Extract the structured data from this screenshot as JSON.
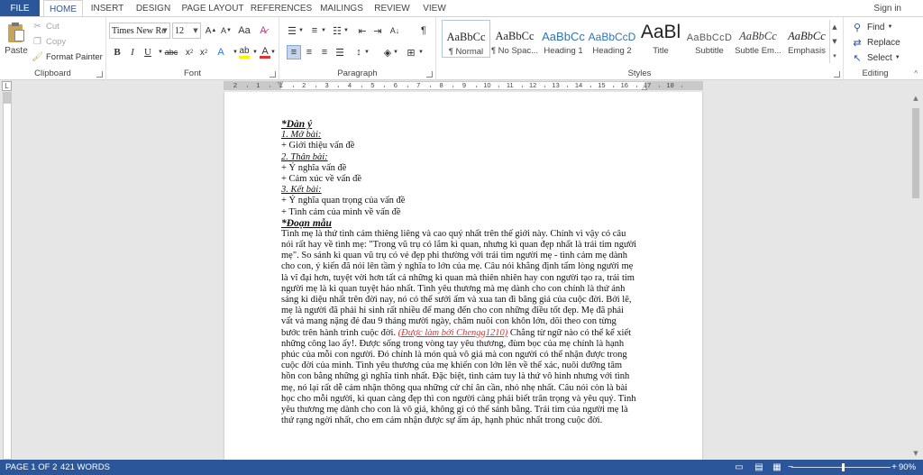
{
  "tabs": {
    "file": "FILE",
    "home": "HOME",
    "insert": "INSERT",
    "design": "DESIGN",
    "page_layout": "PAGE LAYOUT",
    "references": "REFERENCES",
    "mailings": "MAILINGS",
    "review": "REVIEW",
    "view": "VIEW",
    "sign_in": "Sign in"
  },
  "clipboard": {
    "paste": "Paste",
    "cut": "Cut",
    "copy": "Copy",
    "format_painter": "Format Painter",
    "label": "Clipboard"
  },
  "font": {
    "name": "Times New Ro",
    "size": "12",
    "label": "Font"
  },
  "paragraph": {
    "label": "Paragraph"
  },
  "styles": {
    "label": "Styles",
    "items": [
      {
        "sample": "AaBbCc",
        "name": "¶ Normal"
      },
      {
        "sample": "AaBbCc",
        "name": "¶ No Spac..."
      },
      {
        "sample": "AaBbCc",
        "name": "Heading 1"
      },
      {
        "sample": "AaBbCcD",
        "name": "Heading 2"
      },
      {
        "sample": "AaBl",
        "name": "Title"
      },
      {
        "sample": "AaBbCcD",
        "name": "Subtitle"
      },
      {
        "sample": "AaBbCc",
        "name": "Subtle Em..."
      },
      {
        "sample": "AaBbCc",
        "name": "Emphasis"
      }
    ]
  },
  "editing": {
    "find": "Find",
    "replace": "Replace",
    "select": "Select",
    "label": "Editing"
  },
  "ruler": {
    "labels": [
      "2",
      "1",
      "1",
      "2",
      "3",
      "4",
      "5",
      "6",
      "7",
      "8",
      "9",
      "10",
      "11",
      "12",
      "13",
      "14",
      "15",
      "16",
      "17",
      "18"
    ]
  },
  "document": {
    "outline_title": "*Dàn ý",
    "mo_bai": "1. Mở bài:",
    "l1": "+ Giới thiệu vấn đề",
    "than_bai": "2. Thân bài:",
    "l2": "+ Ý nghĩa vấn đề",
    "l3": "+ Cảm xúc về vấn đề",
    "ket_bai": "3. Kết bài:",
    "l4": "+ Ý nghĩa quan trọng của vấn đề",
    "l5": "+ Tình cảm của mình về vấn đề",
    "para_title": "*Đoạn mẫu",
    "p": [
      "Tình mẹ là thứ tình cảm thiêng liêng và cao quý nhất trên thế giới này. Chính vì vậy có câu",
      "nói rất hay về tình mẹ: \"Trong vũ trụ có lắm kì quan, nhưng kì quan đẹp nhất là trái tim người",
      "mẹ\". So sánh kì quan vũ trụ có vẻ đẹp phi thường với trái tim người mẹ - tình cảm mẹ dành",
      "cho con, ý kiến đã nói lên tầm ý nghĩa to lớn của mẹ. Câu nói khẳng định tấm lòng người mẹ",
      "là vĩ đại hơn, tuyệt vời hơn tất cả những kì quan mà thiên nhiên hay con người tạo ra, trái tim",
      "người mẹ là kì quan tuyệt hảo nhất. Tình yêu thương mà mẹ dành cho con chính là thứ ánh",
      "sáng kì diệu nhất trên đời nay, nó có thể sưởi ấm và xua tan đi băng giá của cuộc đời.  Bởi lẽ,",
      "mẹ là người đã phải hi sinh rất nhiều để mang đến cho con những điều tốt đẹp. Mẹ đã phải",
      "vất vả mang nặng đẻ đau 9 tháng mười ngày, chăm nuôi con khôn lớn, dõi theo con từng"
    ],
    "p_before_red": "bước trên hành trình cuộc đời. ",
    "red": "(Được làm bởi Chengg1210)",
    "p_after_red": " Chẳng từ ngữ nào có thể kể xiết",
    "p2": [
      "những công lao ấy!. Được sống trong vòng tay yêu thương, đùm bọc của mẹ chính là hạnh",
      "phúc của mỗi con người. Đó chính là món quà vô giá mà con người có thể nhận được trong",
      "cuộc đời của mình. Tình yêu thương của mẹ khiến con lớn lên về thể xác, nuôi dưỡng tâm",
      "hồn con bằng những gì nghĩa tình nhất. Đặc biệt, tình cảm tuy là thứ vô hình nhưng với tình",
      "mẹ, nó lại rất dễ cảm nhận thông qua những cử chỉ ân cần, nhỏ nhẹ nhất. Câu nói còn là bài",
      "học cho mỗi người, kì quan càng đẹp thì con người càng phải biết trân trọng và yêu quý. Tình",
      "yêu thương mẹ dành cho con là vô giá, không gì có thể sánh bằng. Trái tim của người mẹ là",
      "thứ rạng ngời nhất, cho em cảm nhận được sự ấm áp, hạnh phúc nhất trong cuộc đời."
    ]
  },
  "status": {
    "page": "PAGE 1 OF 2",
    "words": "421 WORDS",
    "zoom": "90%"
  },
  "colors": {
    "accent": "#2b579a",
    "font_color_bar": "#e2322f",
    "highlight_bar": "#fff200",
    "red_text": "#e2322f"
  }
}
